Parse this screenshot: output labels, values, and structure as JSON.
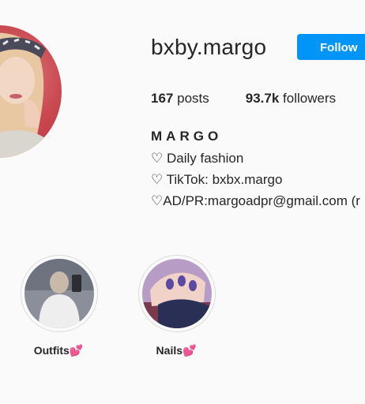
{
  "profile": {
    "username": "bxby.margo",
    "follow_label": "Follow",
    "posts_count": "167",
    "posts_label": "posts",
    "followers_count": "93.7k",
    "followers_label": "followers",
    "full_name": "MARGO",
    "bio": [
      "♡ Daily fashion",
      "♡ TikTok: bxbx.margo",
      "♡AD/PR:margoadpr@gmail.com (r"
    ]
  },
  "highlights": [
    {
      "label": "Outfits💕"
    },
    {
      "label": "Nails💕"
    }
  ],
  "colors": {
    "accent": "#0095f6",
    "avatar_bg": "#c9474f",
    "text": "#262626"
  }
}
